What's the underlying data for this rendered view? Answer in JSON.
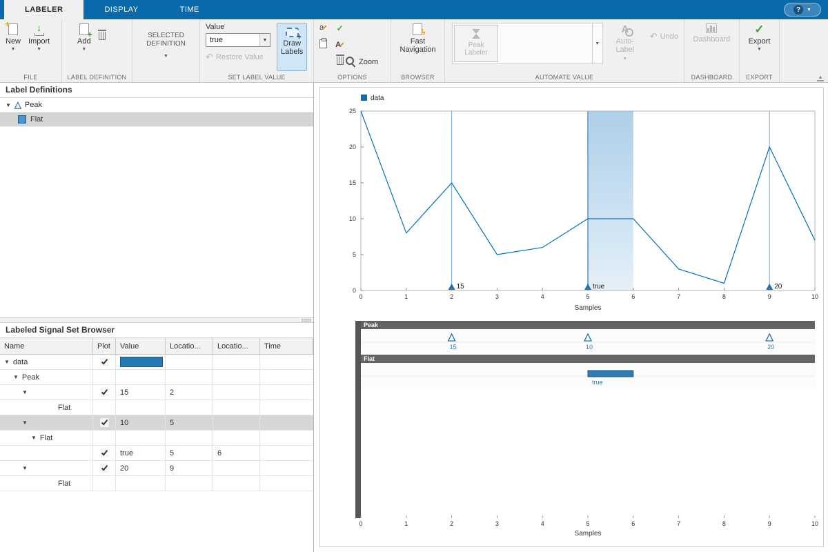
{
  "icons": {
    "caret_down": "▼",
    "caret_up": "▲",
    "check": "✓",
    "undo": "↶",
    "help": "?",
    "peak_triangle": "△",
    "import_arrow": "↓",
    "plus": "+",
    "letter_a_lower": "a",
    "letter_a_upper": "A"
  },
  "tabbar": {
    "tabs": [
      {
        "label": "LABELER",
        "active": true
      },
      {
        "label": "DISPLAY",
        "active": false
      },
      {
        "label": "TIME",
        "active": false
      }
    ]
  },
  "ribbon": {
    "file": {
      "section": "FILE",
      "new_label": "New",
      "import_label": "Import"
    },
    "label_definition": {
      "section": "LABEL DEFINITION",
      "add_label": "Add"
    },
    "selected_definition": {
      "section": "",
      "line1": "SELECTED",
      "line2": "DEFINITION"
    },
    "set_label_value": {
      "section": "SET LABEL VALUE",
      "value_label": "Value",
      "value_current": "true",
      "restore_label": "Restore Value",
      "draw_line1": "Draw",
      "draw_line2": "Labels"
    },
    "options": {
      "section": "OPTIONS",
      "zoom_label": "Zoom"
    },
    "browser": {
      "section": "BROWSER",
      "fast_line1": "Fast",
      "fast_line2": "Navigation"
    },
    "automate": {
      "section": "AUTOMATE VALUE",
      "gallery_line1": "Peak",
      "gallery_line2": "Labeler",
      "auto_line1": "Auto-",
      "auto_line2": "Label",
      "undo_label": "Undo"
    },
    "dashboard": {
      "section": "DASHBOARD",
      "button_label": "Dashboard"
    },
    "export": {
      "section": "EXPORT",
      "button_label": "Export"
    }
  },
  "label_definitions": {
    "title": "Label Definitions",
    "items": [
      {
        "label": "Peak",
        "selected": false
      },
      {
        "label": "Flat",
        "selected": true
      }
    ]
  },
  "browser_table": {
    "title": "Labeled Signal Set Browser",
    "columns": [
      "Name",
      "Plot",
      "Value",
      "Locatio...",
      "Locatio...",
      "Time"
    ],
    "rows": [
      {
        "name": "data",
        "indent": 0,
        "arrow": true,
        "plot": true,
        "value_bar": true,
        "value": "",
        "loc1": "",
        "loc2": "",
        "time": "",
        "selected": false
      },
      {
        "name": "Peak",
        "indent": 1,
        "arrow": true,
        "plot": false,
        "value_bar": false,
        "value": "",
        "loc1": "",
        "loc2": "",
        "time": "",
        "selected": false
      },
      {
        "name": "",
        "indent": 2,
        "arrow": true,
        "plot": true,
        "value_bar": false,
        "value": "15",
        "loc1": "2",
        "loc2": "",
        "time": "",
        "selected": false
      },
      {
        "name": "Flat",
        "indent": 5,
        "arrow": false,
        "plot": false,
        "value_bar": false,
        "value": "",
        "loc1": "",
        "loc2": "",
        "time": "",
        "selected": false
      },
      {
        "name": "",
        "indent": 2,
        "arrow": true,
        "plot": true,
        "value_bar": false,
        "value": "10",
        "loc1": "5",
        "loc2": "",
        "time": "",
        "selected": true
      },
      {
        "name": "Flat",
        "indent": 3,
        "arrow": true,
        "plot": false,
        "value_bar": false,
        "value": "",
        "loc1": "",
        "loc2": "",
        "time": "",
        "selected": false
      },
      {
        "name": "",
        "indent": 5,
        "arrow": false,
        "plot": true,
        "value_bar": false,
        "value": "true",
        "loc1": "5",
        "loc2": "6",
        "time": "",
        "selected": false
      },
      {
        "name": "",
        "indent": 2,
        "arrow": true,
        "plot": true,
        "value_bar": false,
        "value": "20",
        "loc1": "9",
        "loc2": "",
        "time": "",
        "selected": false
      },
      {
        "name": "Flat",
        "indent": 5,
        "arrow": false,
        "plot": false,
        "value_bar": false,
        "value": "",
        "loc1": "",
        "loc2": "",
        "time": "",
        "selected": false
      }
    ]
  },
  "chart_data": [
    {
      "type": "line",
      "legend": [
        "data"
      ],
      "x": [
        0,
        1,
        2,
        3,
        4,
        5,
        6,
        7,
        8,
        9,
        10
      ],
      "y": [
        25,
        8,
        15,
        5,
        6,
        10,
        10,
        3,
        1,
        20,
        7
      ],
      "xlabel": "Samples",
      "xlim": [
        0,
        10
      ],
      "ylim": [
        0,
        25
      ],
      "xticks": [
        0,
        1,
        2,
        3,
        4,
        5,
        6,
        7,
        8,
        9,
        10
      ],
      "yticks": [
        0,
        5,
        10,
        15,
        20,
        25
      ],
      "line_color": "#0072BD",
      "grid": false,
      "legend_position": "top-left",
      "peak_lines": [
        2,
        5,
        9
      ],
      "point_labels": [
        {
          "x": 2,
          "text": "15"
        },
        {
          "x": 5,
          "text": "true"
        },
        {
          "x": 9,
          "text": "20"
        }
      ],
      "region": {
        "x1": 5,
        "x2": 6,
        "fill_top": "#aecfe9",
        "fill_bottom": "#e4f0f9"
      }
    },
    {
      "type": "label-viewer",
      "strips": [
        {
          "name": "Peak",
          "markers": [
            {
              "x": 2,
              "label": "15"
            },
            {
              "x": 5,
              "label": "10"
            },
            {
              "x": 9,
              "label": "20"
            }
          ]
        },
        {
          "name": "Flat",
          "regions": [
            {
              "x1": 5,
              "x2": 6,
              "label": "true"
            }
          ]
        }
      ],
      "xticks": [
        0,
        1,
        2,
        3,
        4,
        5,
        6,
        7,
        8,
        9,
        10
      ],
      "xlim": [
        0,
        10
      ],
      "xlabel": "Samples",
      "marker_color": "#1a6faf",
      "bar_color": "#2e7bb5"
    }
  ]
}
